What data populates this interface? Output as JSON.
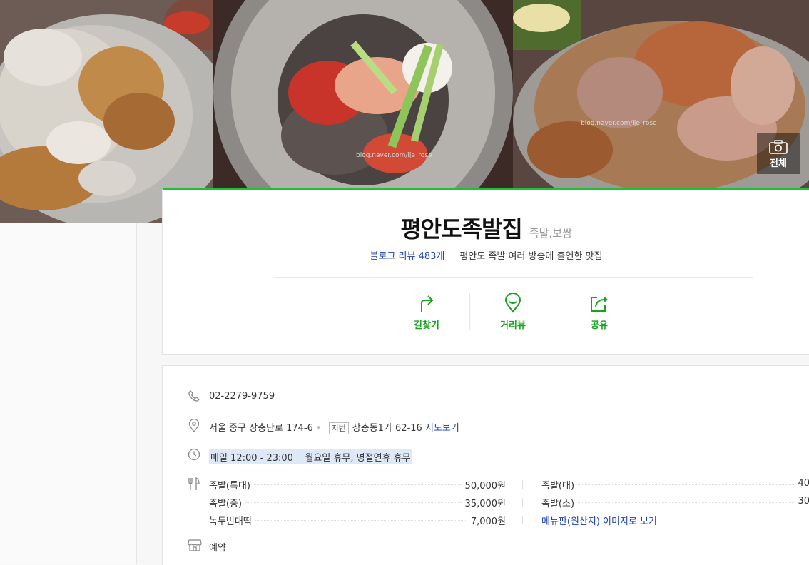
{
  "gallery": {
    "all_photos_label": "전체",
    "watermark_2": "blog.naver.com/lje_rose",
    "watermark_3": "blog.naver.com/lje_rose"
  },
  "place": {
    "name": "평안도족발집",
    "category": "족발,보쌈",
    "blog_review_label": "블로그 리뷰",
    "blog_review_count": "483개",
    "description": "평안도 족발 여러 방송에 출연한 맛집"
  },
  "actions": [
    {
      "label": "길찾기",
      "icon": "directions-icon"
    },
    {
      "label": "거리뷰",
      "icon": "street-view-icon"
    },
    {
      "label": "공유",
      "icon": "share-icon"
    }
  ],
  "info": {
    "phone": "02-2279-9759",
    "address": "서울 중구 장충단로 174-6",
    "jibun_badge": "지번",
    "jibun_address": "장충동1가 62-16",
    "map_link": "지도보기",
    "hours": "매일 12:00 - 23:00    월요일 휴무, 명절연휴 휴무",
    "reservation": "예약"
  },
  "menu": [
    {
      "name": "족발(특대)",
      "price": "50,000원"
    },
    {
      "name": "족발(대)",
      "price": "40"
    },
    {
      "name": "족발(중)",
      "price": "35,000원"
    },
    {
      "name": "족발(소)",
      "price": "30"
    },
    {
      "name": "녹두빈대떡",
      "price": "7,000원"
    }
  ],
  "menu_image_link": "메뉴판(원산지) 이미지로 보기",
  "colors": {
    "accent": "#1fbf3a",
    "action_text": "#17a31f",
    "link": "#1a3fb0"
  }
}
